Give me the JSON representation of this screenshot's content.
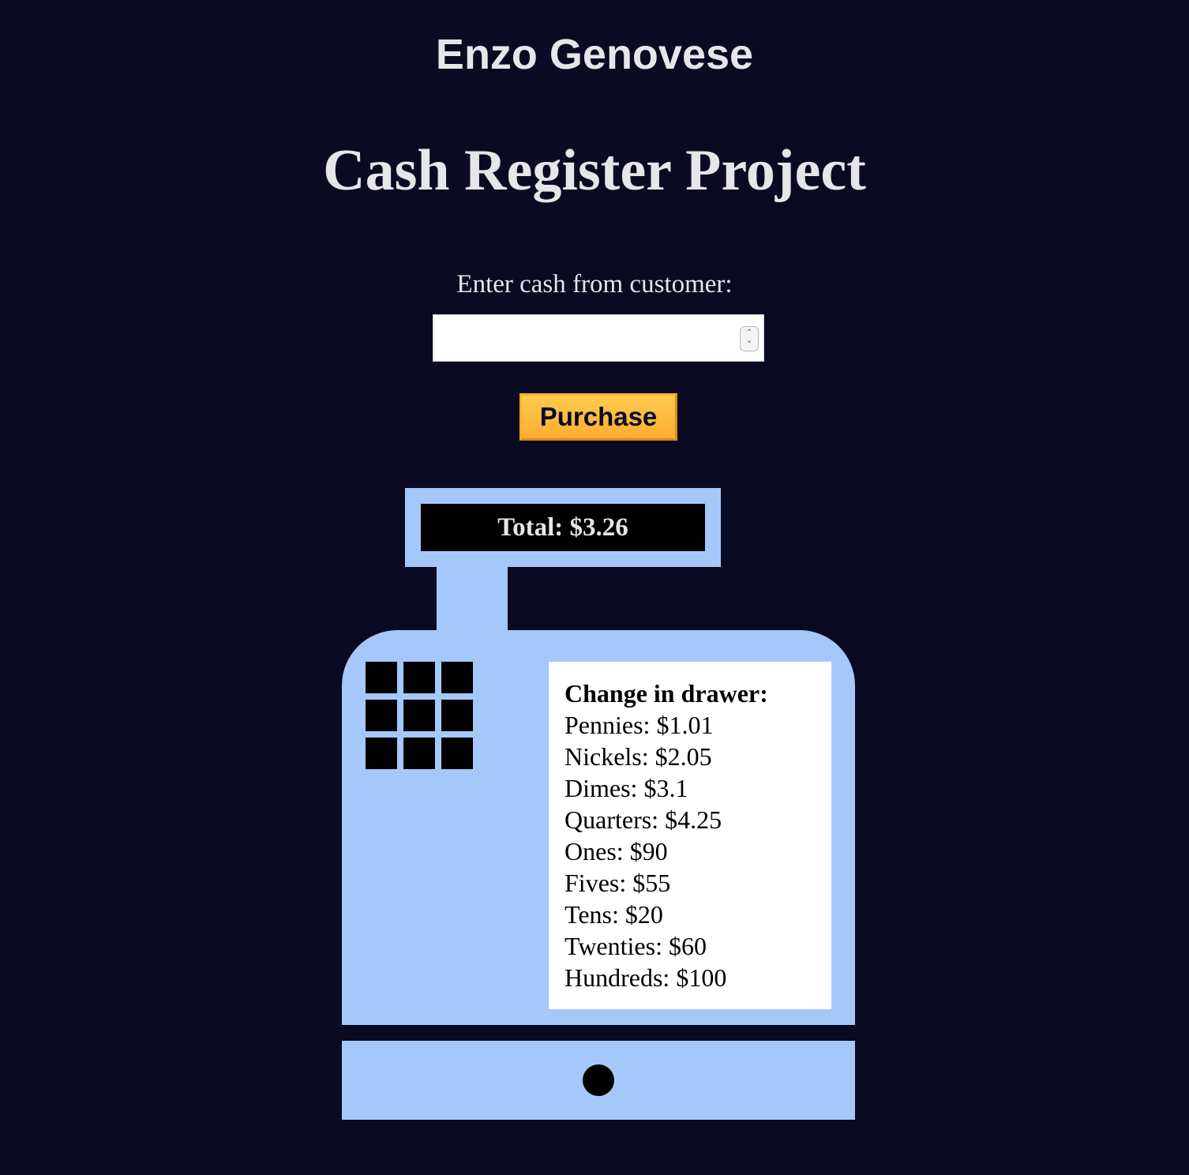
{
  "header": {
    "author": "Enzo Genovese",
    "title": "Cash Register Project"
  },
  "form": {
    "cash_label": "Enter cash from customer:",
    "cash_value": "",
    "purchase_label": "Purchase"
  },
  "register": {
    "total_text": "Total: $3.26",
    "drawer_heading": "Change in drawer:",
    "drawer_items": [
      "Pennies: $1.01",
      "Nickels: $2.05",
      "Dimes: $3.1",
      "Quarters: $4.25",
      "Ones: $90",
      "Fives: $55",
      "Tens: $20",
      "Twenties: $60",
      "Hundreds: $100"
    ]
  },
  "colors": {
    "background": "#0a0a23",
    "register": "#a5c8fa",
    "button": "#feac32",
    "text": "#e6e6e9"
  },
  "icons": {
    "spinner_up": "chevron-up-icon",
    "spinner_down": "chevron-down-icon"
  }
}
